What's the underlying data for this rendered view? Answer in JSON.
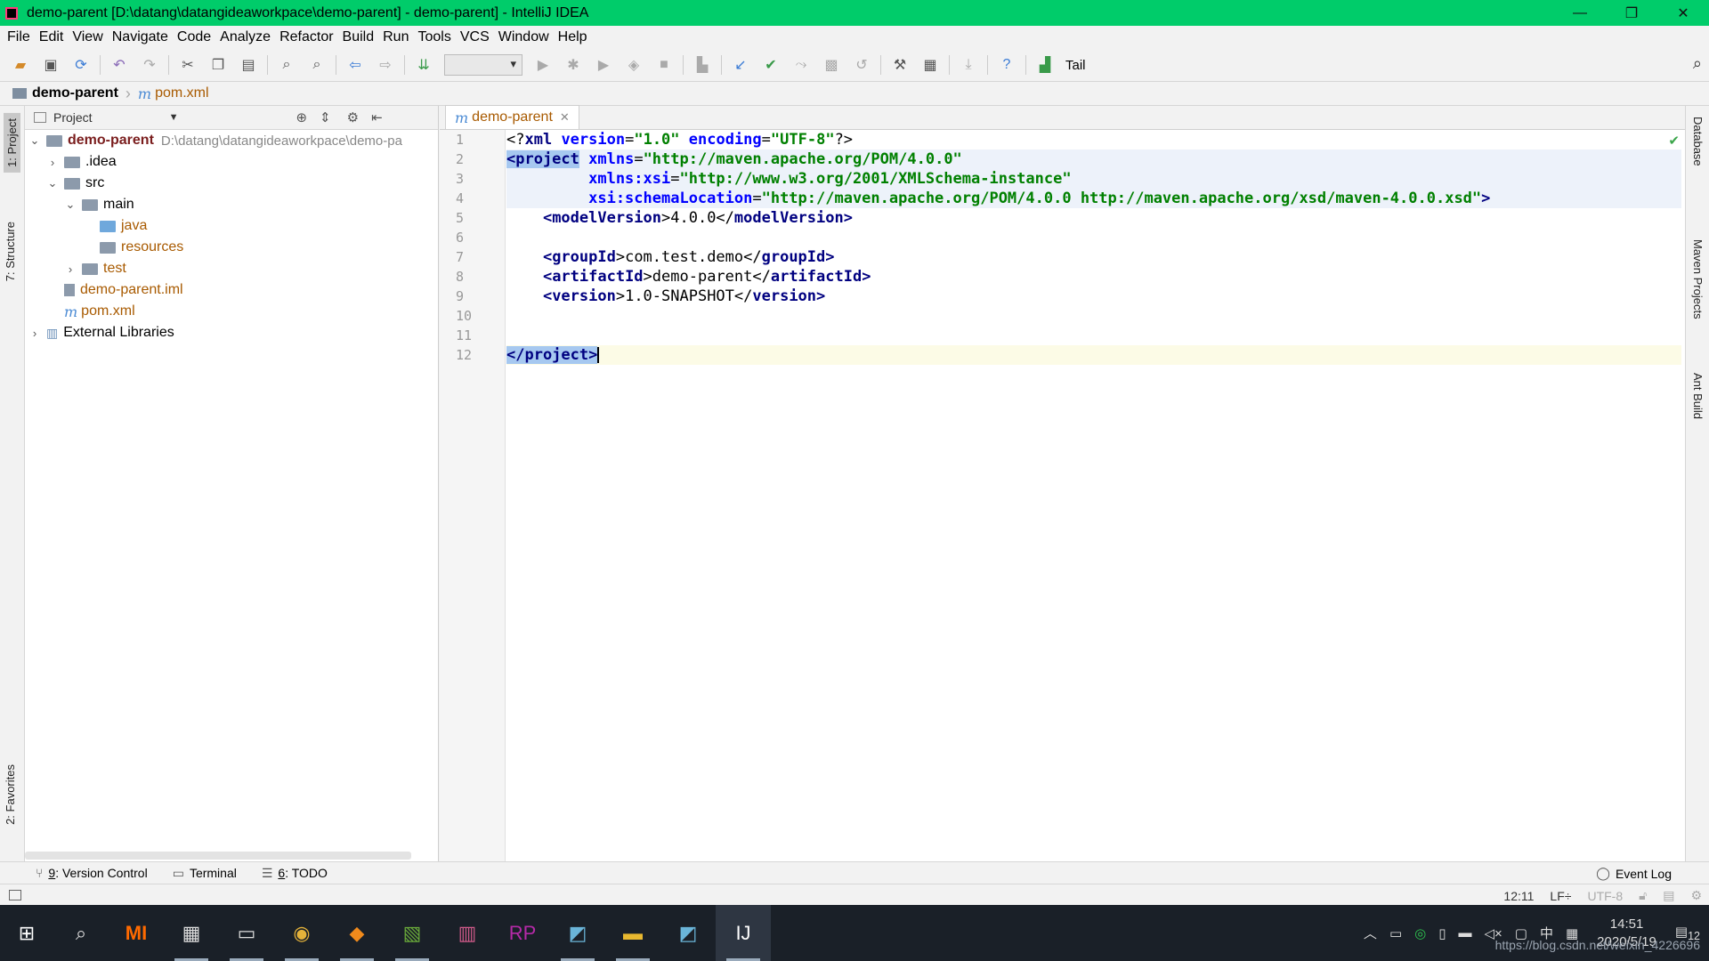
{
  "window": {
    "title": "demo-parent [D:\\datang\\datangideaworkpace\\demo-parent] - demo-parent] - IntelliJ IDEA",
    "controls": [
      "—",
      "❐",
      "✕"
    ]
  },
  "menu": [
    "File",
    "Edit",
    "View",
    "Navigate",
    "Code",
    "Analyze",
    "Refactor",
    "Build",
    "Run",
    "Tools",
    "VCS",
    "Window",
    "Help"
  ],
  "toolbar": {
    "tail_label": "Tail"
  },
  "navbar": {
    "project": "demo-parent",
    "file": "pom.xml"
  },
  "left_tabs": [
    "1: Project",
    "7: Structure",
    "2: Favorites"
  ],
  "right_tabs": [
    "Database",
    "Maven Projects",
    "Ant Build"
  ],
  "project_panel": {
    "header": "Project",
    "tree": [
      {
        "label": "demo-parent",
        "path": "D:\\datang\\datangideaworkpace\\demo-pa"
      },
      {
        "label": ".idea"
      },
      {
        "label": "src"
      },
      {
        "label": "main"
      },
      {
        "label": "java"
      },
      {
        "label": "resources"
      },
      {
        "label": "test"
      },
      {
        "label": "demo-parent.iml"
      },
      {
        "label": "pom.xml"
      },
      {
        "label": "External Libraries"
      }
    ]
  },
  "editor": {
    "tab": "demo-parent",
    "line_numbers": [
      "1",
      "2",
      "3",
      "4",
      "5",
      "6",
      "7",
      "8",
      "9",
      "10",
      "11",
      "12"
    ],
    "lines": {
      "l1": {
        "a": "<?",
        "b": "xml ",
        "c": "version",
        "d": "=",
        "e": "\"1.0\"",
        "f": " encoding",
        "g": "=",
        "h": "\"UTF-8\"",
        "i": "?>"
      },
      "l2": {
        "a": "<project",
        "b": " xmlns",
        "c": "=",
        "d": "\"http://maven.apache.org/POM/4.0.0\""
      },
      "l3": {
        "a": "         xmlns:xsi",
        "b": "=",
        "c": "\"http://www.w3.org/2001/XMLSchema-instance\""
      },
      "l4": {
        "a": "         xsi:schemaLocation",
        "b": "=",
        "c": "\"http://maven.apache.org/POM/4.0.0 http://maven.apache.org/xsd/maven-4.0.0.xsd\"",
        "d": ">"
      },
      "l5": {
        "a": "    <",
        "b": "modelVersion",
        "c": ">4.0.0</",
        "d": "modelVersion",
        "e": ">"
      },
      "l7": {
        "a": "    <",
        "b": "groupId",
        "c": ">com.test.demo</",
        "d": "groupId",
        "e": ">"
      },
      "l8": {
        "a": "    <",
        "b": "artifactId",
        "c": ">demo-parent</",
        "d": "artifactId",
        "e": ">"
      },
      "l9": {
        "a": "    <",
        "b": "version",
        "c": ">1.0-SNAPSHOT</",
        "d": "version",
        "e": ">"
      },
      "l12": {
        "a": "</project>"
      }
    }
  },
  "bottom_tools": [
    {
      "num": "9",
      "label": ": Version Control"
    },
    {
      "label": "Terminal"
    },
    {
      "num": "6",
      "label": ": TODO"
    }
  ],
  "event_log": "Event Log",
  "status": {
    "position": "12:11",
    "line_sep": "LF÷",
    "encoding": "UTF-8"
  },
  "taskbar": {
    "time": "14:51",
    "date": "2020/5/19",
    "lang": "中",
    "notif": "12"
  },
  "watermark": "https://blog.csdn.net/weixin_4226696"
}
